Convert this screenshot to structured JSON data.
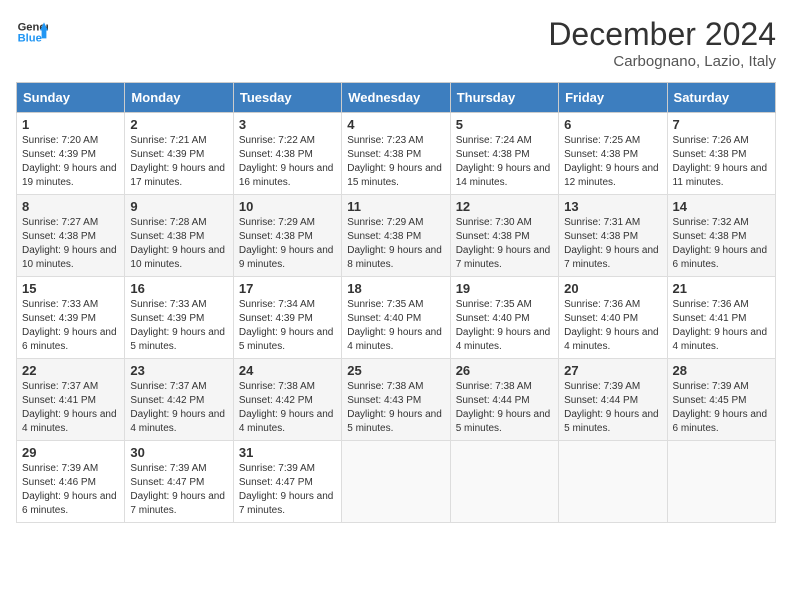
{
  "logo": {
    "line1": "General",
    "line2": "Blue"
  },
  "title": "December 2024",
  "location": "Carbognano, Lazio, Italy",
  "days_of_week": [
    "Sunday",
    "Monday",
    "Tuesday",
    "Wednesday",
    "Thursday",
    "Friday",
    "Saturday"
  ],
  "weeks": [
    [
      {
        "day": "1",
        "sunrise": "7:20 AM",
        "sunset": "4:39 PM",
        "daylight": "9 hours and 19 minutes."
      },
      {
        "day": "2",
        "sunrise": "7:21 AM",
        "sunset": "4:39 PM",
        "daylight": "9 hours and 17 minutes."
      },
      {
        "day": "3",
        "sunrise": "7:22 AM",
        "sunset": "4:38 PM",
        "daylight": "9 hours and 16 minutes."
      },
      {
        "day": "4",
        "sunrise": "7:23 AM",
        "sunset": "4:38 PM",
        "daylight": "9 hours and 15 minutes."
      },
      {
        "day": "5",
        "sunrise": "7:24 AM",
        "sunset": "4:38 PM",
        "daylight": "9 hours and 14 minutes."
      },
      {
        "day": "6",
        "sunrise": "7:25 AM",
        "sunset": "4:38 PM",
        "daylight": "9 hours and 12 minutes."
      },
      {
        "day": "7",
        "sunrise": "7:26 AM",
        "sunset": "4:38 PM",
        "daylight": "9 hours and 11 minutes."
      }
    ],
    [
      {
        "day": "8",
        "sunrise": "7:27 AM",
        "sunset": "4:38 PM",
        "daylight": "9 hours and 10 minutes."
      },
      {
        "day": "9",
        "sunrise": "7:28 AM",
        "sunset": "4:38 PM",
        "daylight": "9 hours and 10 minutes."
      },
      {
        "day": "10",
        "sunrise": "7:29 AM",
        "sunset": "4:38 PM",
        "daylight": "9 hours and 9 minutes."
      },
      {
        "day": "11",
        "sunrise": "7:29 AM",
        "sunset": "4:38 PM",
        "daylight": "9 hours and 8 minutes."
      },
      {
        "day": "12",
        "sunrise": "7:30 AM",
        "sunset": "4:38 PM",
        "daylight": "9 hours and 7 minutes."
      },
      {
        "day": "13",
        "sunrise": "7:31 AM",
        "sunset": "4:38 PM",
        "daylight": "9 hours and 7 minutes."
      },
      {
        "day": "14",
        "sunrise": "7:32 AM",
        "sunset": "4:38 PM",
        "daylight": "9 hours and 6 minutes."
      }
    ],
    [
      {
        "day": "15",
        "sunrise": "7:33 AM",
        "sunset": "4:39 PM",
        "daylight": "9 hours and 6 minutes."
      },
      {
        "day": "16",
        "sunrise": "7:33 AM",
        "sunset": "4:39 PM",
        "daylight": "9 hours and 5 minutes."
      },
      {
        "day": "17",
        "sunrise": "7:34 AM",
        "sunset": "4:39 PM",
        "daylight": "9 hours and 5 minutes."
      },
      {
        "day": "18",
        "sunrise": "7:35 AM",
        "sunset": "4:40 PM",
        "daylight": "9 hours and 4 minutes."
      },
      {
        "day": "19",
        "sunrise": "7:35 AM",
        "sunset": "4:40 PM",
        "daylight": "9 hours and 4 minutes."
      },
      {
        "day": "20",
        "sunrise": "7:36 AM",
        "sunset": "4:40 PM",
        "daylight": "9 hours and 4 minutes."
      },
      {
        "day": "21",
        "sunrise": "7:36 AM",
        "sunset": "4:41 PM",
        "daylight": "9 hours and 4 minutes."
      }
    ],
    [
      {
        "day": "22",
        "sunrise": "7:37 AM",
        "sunset": "4:41 PM",
        "daylight": "9 hours and 4 minutes."
      },
      {
        "day": "23",
        "sunrise": "7:37 AM",
        "sunset": "4:42 PM",
        "daylight": "9 hours and 4 minutes."
      },
      {
        "day": "24",
        "sunrise": "7:38 AM",
        "sunset": "4:42 PM",
        "daylight": "9 hours and 4 minutes."
      },
      {
        "day": "25",
        "sunrise": "7:38 AM",
        "sunset": "4:43 PM",
        "daylight": "9 hours and 5 minutes."
      },
      {
        "day": "26",
        "sunrise": "7:38 AM",
        "sunset": "4:44 PM",
        "daylight": "9 hours and 5 minutes."
      },
      {
        "day": "27",
        "sunrise": "7:39 AM",
        "sunset": "4:44 PM",
        "daylight": "9 hours and 5 minutes."
      },
      {
        "day": "28",
        "sunrise": "7:39 AM",
        "sunset": "4:45 PM",
        "daylight": "9 hours and 6 minutes."
      }
    ],
    [
      {
        "day": "29",
        "sunrise": "7:39 AM",
        "sunset": "4:46 PM",
        "daylight": "9 hours and 6 minutes."
      },
      {
        "day": "30",
        "sunrise": "7:39 AM",
        "sunset": "4:47 PM",
        "daylight": "9 hours and 7 minutes."
      },
      {
        "day": "31",
        "sunrise": "7:39 AM",
        "sunset": "4:47 PM",
        "daylight": "9 hours and 7 minutes."
      },
      null,
      null,
      null,
      null
    ]
  ]
}
